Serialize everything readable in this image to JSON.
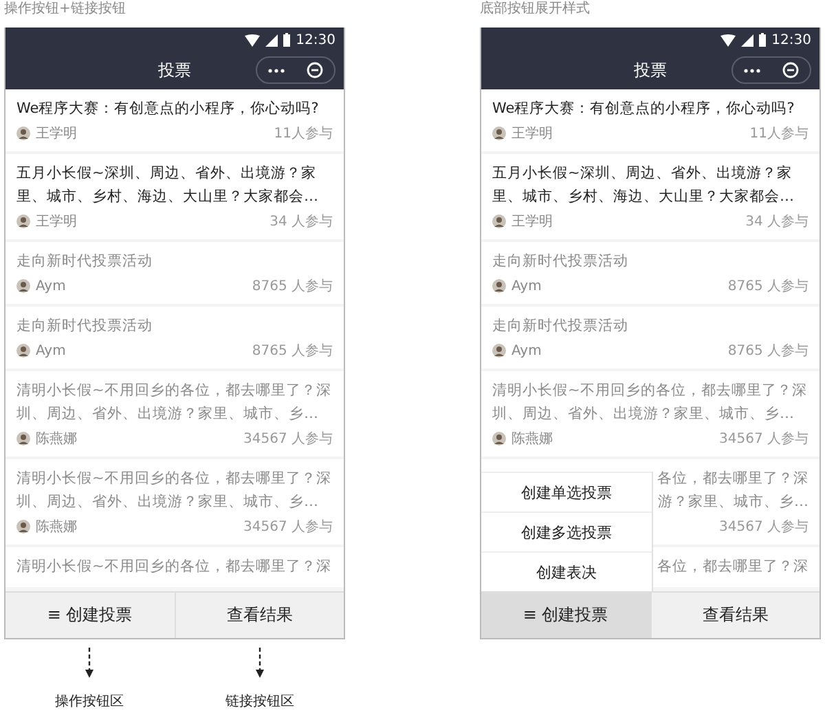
{
  "panels": [
    {
      "caption": "操作按钮+链接按钮",
      "status_time": "12:30",
      "nav_title": "投票",
      "items": [
        {
          "title": "We程序大赛：有创意点的小程序，你心动吗?",
          "author": "王学明",
          "count": "11人参与",
          "muted": false
        },
        {
          "title": "五月小长假~深圳、周边、省外、出境游？家里、城市、乡村、海边、大山里？大家都会…",
          "author": "王学明",
          "count": "34 人参与",
          "muted": false
        },
        {
          "title": "走向新时代投票活动",
          "author": "Aym",
          "count": "8765 人参与",
          "muted": true
        },
        {
          "title": "走向新时代投票活动",
          "author": "Aym",
          "count": "8765 人参与",
          "muted": true
        },
        {
          "title": "清明小长假~不用回乡的各位，都去哪里了？深圳、周边、省外、出境游？家里、城市、乡…",
          "author": "陈燕娜",
          "count": "34567 人参与",
          "muted": true
        },
        {
          "title": "清明小长假~不用回乡的各位，都去哪里了？深圳、周边、省外、出境游？家里、城市、乡…",
          "author": "陈燕娜",
          "count": "34567 人参与",
          "muted": true
        },
        {
          "title": "清明小长假~不用回乡的各位，都去哪里了？深",
          "muted": true
        }
      ],
      "buttons": [
        {
          "label": "≡ 创建投票",
          "pressed": false
        },
        {
          "label": "查看结果",
          "pressed": false
        }
      ],
      "annotations": [
        "操作按钮区",
        "链接按钮区"
      ]
    },
    {
      "caption": "底部按钮展开样式",
      "status_time": "12:30",
      "nav_title": "投票",
      "items": [
        {
          "title": "We程序大赛：有创意点的小程序，你心动吗?",
          "author": "王学明",
          "count": "11人参与",
          "muted": false
        },
        {
          "title": "五月小长假~深圳、周边、省外、出境游？家里、城市、乡村、海边、大山里？大家都会…",
          "author": "王学明",
          "count": "34 人参与",
          "muted": false
        },
        {
          "title": "走向新时代投票活动",
          "author": "Aym",
          "count": "8765 人参与",
          "muted": true
        },
        {
          "title": "走向新时代投票活动",
          "author": "Aym",
          "count": "8765 人参与",
          "muted": true
        },
        {
          "title": "清明小长假~不用回乡的各位，都去哪里了？深圳、周边、省外、出境游？家里、城市、乡…",
          "author": "陈燕娜",
          "count": "34567 人参与",
          "muted": true
        },
        {
          "title_lines": [
            "各位，都去哪里了？深",
            "游？家里、城市、乡…"
          ],
          "count": "34567 人参与",
          "muted": true
        },
        {
          "title_lines": [
            "各位，都去哪里了？深"
          ],
          "muted": true
        }
      ],
      "buttons": [
        {
          "label": "≡ 创建投票",
          "pressed": true
        },
        {
          "label": "查看结果",
          "pressed": false
        }
      ],
      "menu": [
        "创建单选投票",
        "创建多选投票",
        "创建表决"
      ]
    }
  ]
}
